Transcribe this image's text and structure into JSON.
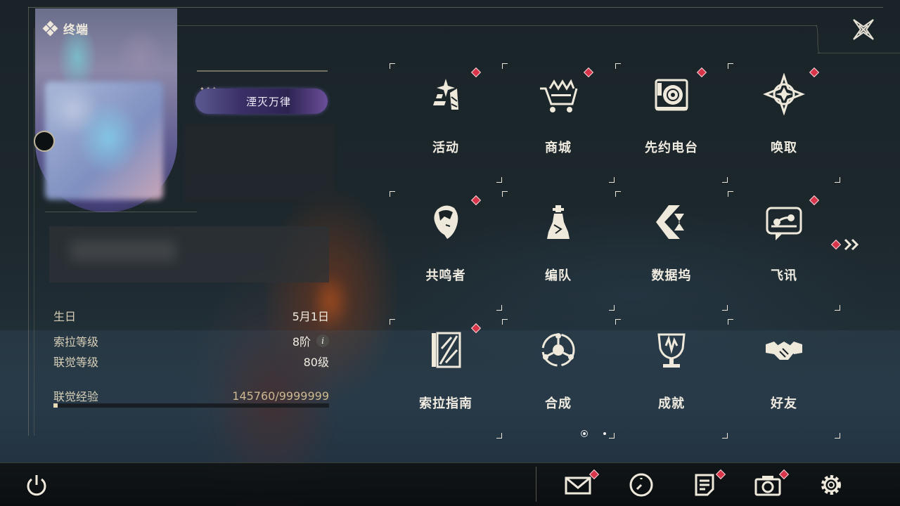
{
  "window": {
    "title": "终端"
  },
  "profile": {
    "badge_title": "湮灭万律",
    "stats": [
      {
        "label": "生日",
        "value": "5月1日"
      },
      {
        "label": "索拉等级",
        "value": "8阶"
      },
      {
        "label": "联觉等级",
        "value": "80级"
      }
    ],
    "experience": {
      "label": "联觉经验",
      "value": "145760/9999999",
      "progress": 0.0146
    }
  },
  "menu": {
    "items": [
      {
        "label": "活动",
        "icon": "event-icon",
        "notify": true
      },
      {
        "label": "商城",
        "icon": "shop-cart-icon",
        "notify": true
      },
      {
        "label": "先约电台",
        "icon": "radio-icon",
        "notify": true
      },
      {
        "label": "唤取",
        "icon": "convene-icon",
        "notify": true
      },
      {
        "label": "共鸣者",
        "icon": "resonator-icon",
        "notify": true
      },
      {
        "label": "编队",
        "icon": "team-chess-icon",
        "notify": false
      },
      {
        "label": "数据坞",
        "icon": "data-bank-icon",
        "notify": false
      },
      {
        "label": "飞讯",
        "icon": "chat-icon",
        "notify": true
      },
      {
        "label": "索拉指南",
        "icon": "guidebook-icon",
        "notify": true
      },
      {
        "label": "合成",
        "icon": "synthesis-icon",
        "notify": false
      },
      {
        "label": "成就",
        "icon": "trophy-icon",
        "notify": false
      },
      {
        "label": "好友",
        "icon": "handshake-icon",
        "notify": false
      }
    ],
    "page": {
      "current": 1,
      "total": 2
    }
  },
  "bottom_bar": {
    "icons": [
      "power-icon",
      "mail-icon",
      "clock-icon",
      "notes-icon",
      "camera-icon",
      "settings-gear-icon"
    ]
  },
  "colors": {
    "accent": "#eee8dc",
    "notify": "#d8344a",
    "frame": "#c8be9f"
  }
}
